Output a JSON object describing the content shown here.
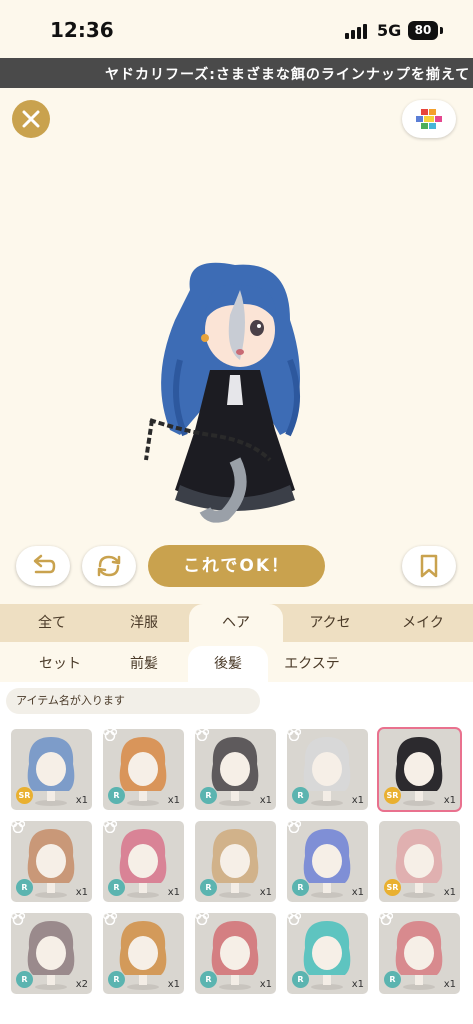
{
  "status_bar": {
    "time": "12:36",
    "network": "5G",
    "battery": "80"
  },
  "ticker": {
    "text": "ヤドカリフーズ:さまざまな餌のラインナップを揃えて"
  },
  "actions": {
    "ok_label": "これでOK！"
  },
  "colors": {
    "accent": "#c9a24e",
    "selected_border": "#e9718e",
    "rarity_r": "#5bb4b0",
    "rarity_sr": "#e9b030"
  },
  "main_tabs": [
    {
      "label": "全て"
    },
    {
      "label": "洋服"
    },
    {
      "label": "ヘア"
    },
    {
      "label": "アクセ"
    },
    {
      "label": "メイク"
    }
  ],
  "main_tabs_active": "ヘア",
  "sub_tabs": [
    {
      "label": "セット"
    },
    {
      "label": "前髪"
    },
    {
      "label": "後髪"
    },
    {
      "label": "エクステ"
    }
  ],
  "sub_tabs_active": "後髪",
  "search": {
    "placeholder": "アイテム名が入ります"
  },
  "items": [
    {
      "rarity": "SR",
      "qty": "x1",
      "color": "#7d9cc9",
      "bear": false,
      "selected": false
    },
    {
      "rarity": "R",
      "qty": "x1",
      "color": "#d9955a",
      "bear": true,
      "selected": false
    },
    {
      "rarity": "R",
      "qty": "x1",
      "color": "#5e5a5c",
      "bear": true,
      "selected": false
    },
    {
      "rarity": "R",
      "qty": "x1",
      "color": "#d8d8d8",
      "bear": true,
      "selected": false
    },
    {
      "rarity": "SR",
      "qty": "x1",
      "color": "#2c2a2e",
      "bear": false,
      "selected": true
    },
    {
      "rarity": "R",
      "qty": "x1",
      "color": "#c99878",
      "bear": true,
      "selected": false
    },
    {
      "rarity": "R",
      "qty": "x1",
      "color": "#d98396",
      "bear": true,
      "selected": false
    },
    {
      "rarity": "R",
      "qty": "x1",
      "color": "#d1b28a",
      "bear": false,
      "selected": false
    },
    {
      "rarity": "R",
      "qty": "x1",
      "color": "#7f8fd6",
      "bear": true,
      "selected": false
    },
    {
      "rarity": "SR",
      "qty": "x1",
      "color": "#e0b0b0",
      "bear": false,
      "selected": false
    },
    {
      "rarity": "R",
      "qty": "x2",
      "color": "#9a8a8c",
      "bear": true,
      "selected": false
    },
    {
      "rarity": "R",
      "qty": "x1",
      "color": "#d39a5a",
      "bear": true,
      "selected": false
    },
    {
      "rarity": "R",
      "qty": "x1",
      "color": "#d47f82",
      "bear": true,
      "selected": false
    },
    {
      "rarity": "R",
      "qty": "x1",
      "color": "#5ec4c0",
      "bear": true,
      "selected": false
    },
    {
      "rarity": "R",
      "qty": "x1",
      "color": "#d88a8e",
      "bear": true,
      "selected": false
    }
  ]
}
